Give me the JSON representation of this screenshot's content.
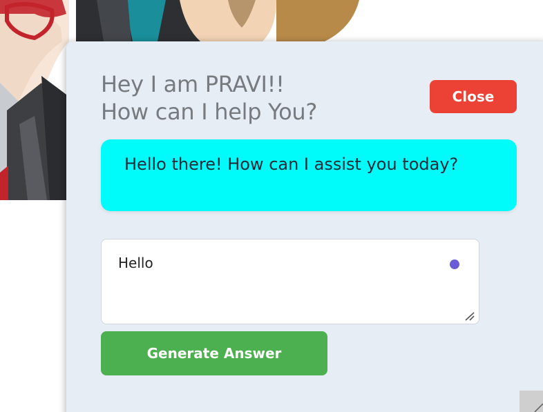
{
  "chat": {
    "greeting_line1": "Hey I am PRAVI!!",
    "greeting_line2": "How can I help You?",
    "close_label": "Close",
    "bot_message": "Hello there! How can I assist you today?",
    "input_value": "Hello",
    "generate_label": "Generate Answer"
  },
  "colors": {
    "panel_bg": "#e7edf4",
    "title_text": "#777a7e",
    "close_button": "#ec4236",
    "bot_bubble": "#00fbfb",
    "input_dot": "#6a5bd6",
    "generate_button": "#4caf50"
  },
  "icons": {
    "textarea_grip": "resize-grip-icon",
    "panel_grip": "panel-resize-grip-icon"
  }
}
